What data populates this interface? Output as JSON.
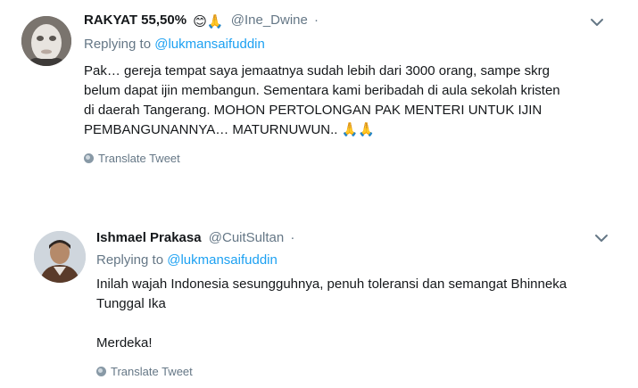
{
  "tweets": [
    {
      "display_name": "RAKYAT 55,50%",
      "handle": "@Ine_Dwine",
      "separator": "·",
      "emojis": [
        "😊",
        "🙏"
      ],
      "replying_prefix": "Replying to",
      "replying_to": "@lukmansaifuddin",
      "lines": [
        "Pak… gereja tempat saya jemaatnya sudah lebih dari 3000 orang, sampe skrg",
        "belum dapat ijin membangun. Sementara kami beribadah di aula sekolah kristen",
        "di daerah Tangerang. MOHON PERTOLONGAN PAK MENTERI UNTUK IJIN",
        "PEMBANGUNANNYA… MATURNUWUN.. 🙏🙏"
      ],
      "translate_label": "Translate Tweet"
    },
    {
      "display_name": "Ishmael Prakasa",
      "handle": "@CuitSultan",
      "separator": "·",
      "replying_prefix": "Replying to",
      "replying_to": "@lukmansaifuddin",
      "lines": [
        "Inilah wajah Indonesia sesungguhnya, penuh toleransi dan semangat Bhinneka",
        "Tunggal Ika"
      ],
      "closing": "Merdeka!",
      "translate_label": "Translate Tweet"
    }
  ],
  "icons": {
    "more": "chevron-down-icon",
    "translate": "globe-icon"
  },
  "colors": {
    "link": "#1da1f2",
    "secondary_text": "#657786",
    "primary_text": "#14171a"
  }
}
